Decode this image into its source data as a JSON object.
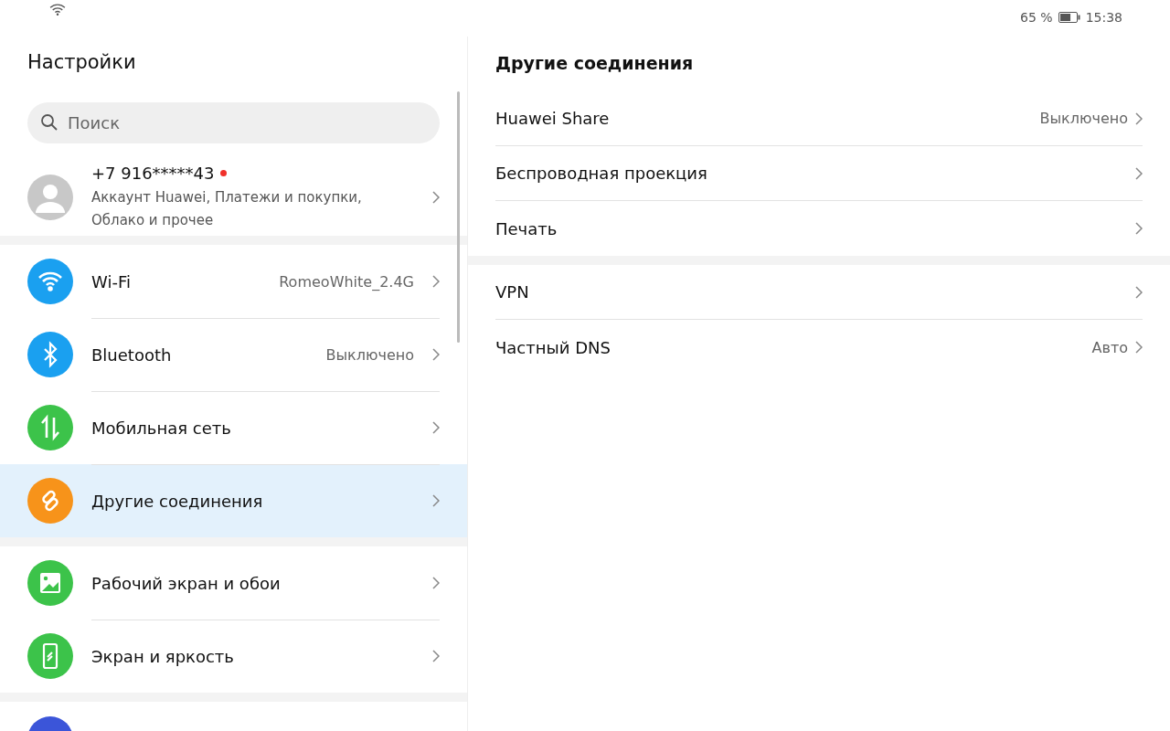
{
  "status_bar": {
    "battery_text": "65 %",
    "battery": {
      "level": 0.65
    },
    "time": "15:38"
  },
  "sidebar": {
    "title": "Настройки",
    "search": {
      "placeholder": "Поиск"
    },
    "account": {
      "phone": "+7 916*****43",
      "notification": true,
      "subtitle": "Аккаунт Huawei, Платежи и покупки, Облако и прочее"
    },
    "groups": [
      {
        "items": [
          {
            "label": "Wi-Fi",
            "value": "RomeoWhite_2.4G",
            "color": "#1aa0f0",
            "selected": false
          },
          {
            "label": "Bluetooth",
            "value": "Выключено",
            "color": "#1aa0f0",
            "selected": false
          },
          {
            "label": "Мобильная сеть",
            "color": "#3cc34a",
            "selected": false
          },
          {
            "label": "Другие соединения",
            "color": "#f7931a",
            "selected": true
          }
        ]
      },
      {
        "items": [
          {
            "label": "Рабочий экран и обои",
            "color": "#3cc34a",
            "selected": false
          },
          {
            "label": "Экран и яркость",
            "color": "#3cc34a",
            "selected": false
          }
        ]
      }
    ]
  },
  "detail": {
    "title": "Другие соединения",
    "groups": [
      {
        "items": [
          {
            "label": "Huawei Share",
            "value": "Выключено"
          },
          {
            "label": "Беспроводная проекция"
          },
          {
            "label": "Печать"
          }
        ]
      },
      {
        "items": [
          {
            "label": "VPN"
          },
          {
            "label": "Частный DNS",
            "value": "Авто"
          }
        ]
      }
    ]
  }
}
